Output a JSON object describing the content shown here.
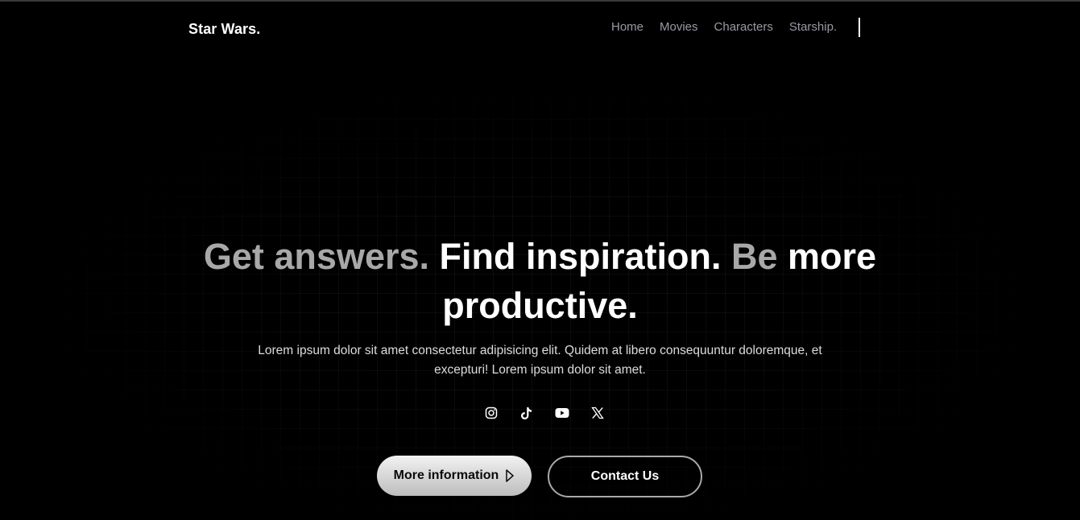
{
  "nav": {
    "brand": "Star Wars.",
    "links": [
      {
        "label": "Home"
      },
      {
        "label": "Movies"
      },
      {
        "label": "Characters"
      },
      {
        "label": "Starship."
      }
    ]
  },
  "hero": {
    "headline_part1": "Get answers. ",
    "headline_part2": "Find inspiration.",
    "headline_part3": " Be ",
    "headline_part4": "more productive.",
    "subtext": "Lorem ipsum dolor sit amet consectetur adipisicing elit. Quidem at libero consequuntur doloremque, et excepturi! Lorem ipsum dolor sit amet.",
    "socials": [
      "instagram-icon",
      "tiktok-icon",
      "youtube-icon",
      "x-icon"
    ]
  },
  "buttons": {
    "more_info_label": "More information",
    "contact_label": "Contact Us"
  },
  "colors": {
    "background": "#000000",
    "text_primary": "#ffffff",
    "text_dim": "#a8a8a8",
    "nav_link": "#9a9aa5"
  }
}
